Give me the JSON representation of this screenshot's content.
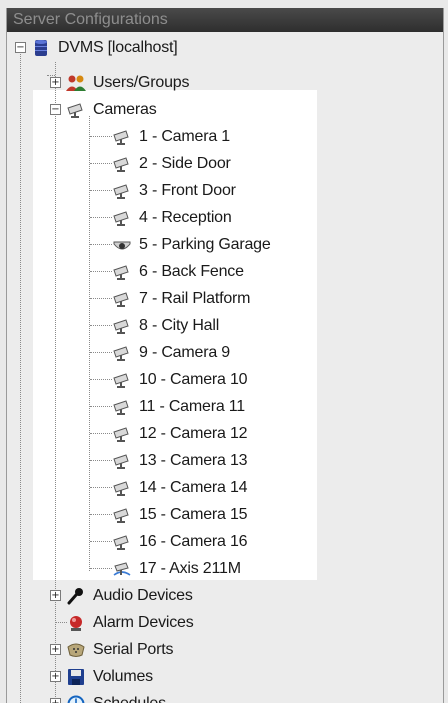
{
  "window": {
    "title": "Server Configurations"
  },
  "tree": {
    "root": {
      "label": "DVMS [localhost]",
      "icon": "database-server-icon"
    },
    "users_groups": {
      "label": "Users/Groups",
      "icon": "users-icon"
    },
    "cameras": {
      "label": "Cameras",
      "icon": "camera-icon",
      "items": [
        {
          "label": "1 - Camera 1",
          "icon": "camera-icon"
        },
        {
          "label": "2 - Side Door",
          "icon": "camera-icon"
        },
        {
          "label": "3 - Front Door",
          "icon": "camera-icon"
        },
        {
          "label": "4 - Reception",
          "icon": "camera-icon"
        },
        {
          "label": "5 - Parking Garage",
          "icon": "dome-camera-icon"
        },
        {
          "label": "6 - Back Fence",
          "icon": "camera-icon"
        },
        {
          "label": "7 - Rail Platform",
          "icon": "camera-icon"
        },
        {
          "label": "8 - City Hall",
          "icon": "camera-icon"
        },
        {
          "label": "9 - Camera 9",
          "icon": "camera-icon"
        },
        {
          "label": "10 - Camera 10",
          "icon": "camera-icon"
        },
        {
          "label": "11 - Camera 11",
          "icon": "camera-icon"
        },
        {
          "label": "12 - Camera 12",
          "icon": "camera-icon"
        },
        {
          "label": "13 - Camera 13",
          "icon": "camera-icon"
        },
        {
          "label": "14 - Camera 14",
          "icon": "camera-icon"
        },
        {
          "label": "15 - Camera 15",
          "icon": "camera-icon"
        },
        {
          "label": "16 - Camera 16",
          "icon": "camera-icon"
        },
        {
          "label": "17 - Axis 211M",
          "icon": "network-camera-icon"
        }
      ]
    },
    "audio_devices": {
      "label": "Audio Devices",
      "icon": "microphone-icon"
    },
    "alarm_devices": {
      "label": "Alarm Devices",
      "icon": "alarm-icon"
    },
    "serial_ports": {
      "label": "Serial Ports",
      "icon": "serial-port-icon"
    },
    "volumes": {
      "label": "Volumes",
      "icon": "floppy-disk-icon"
    },
    "schedules": {
      "label": "Schedules",
      "icon": "clock-icon"
    }
  },
  "expander_symbols": {
    "expanded": "−",
    "collapsed": "+"
  }
}
